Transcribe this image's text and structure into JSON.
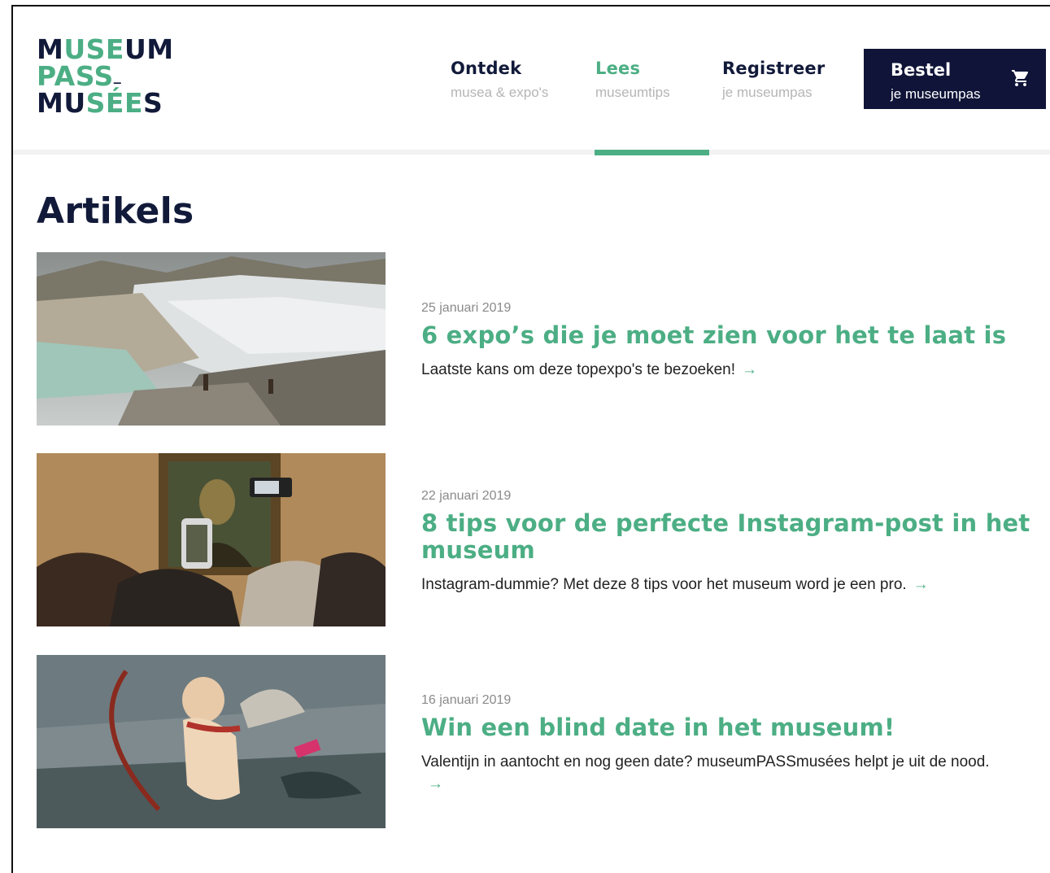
{
  "logo": {
    "line1_a": "M",
    "line1_b": "USE",
    "line1_c": "UM",
    "line2_a": "PASS",
    "line2_b": "_",
    "line3_a": "MU",
    "line3_b": "SÉE",
    "line3_c": "S"
  },
  "nav": [
    {
      "title": "Ontdek",
      "sub": "musea & expo's",
      "active": false
    },
    {
      "title": "Lees",
      "sub": "museumtips",
      "active": true
    },
    {
      "title": "Registreer",
      "sub": "je museumpas",
      "active": false
    }
  ],
  "cta": {
    "title": "Bestel",
    "sub": "je museumpas",
    "icon": "cart-icon"
  },
  "page": {
    "title": "Artikels"
  },
  "articles": [
    {
      "date": "25 januari 2019",
      "title": "6 expo’s die je moet zien voor het te laat is",
      "desc": "Laatste kans om deze topexpo's te bezoeken!",
      "arrow": "→",
      "image": "glacier-photo"
    },
    {
      "date": "22 januari 2019",
      "title": "8 tips voor de perfecte Instagram-post in het museum",
      "desc": "Instagram-dummie? Met deze 8 tips voor het museum word je een pro.",
      "arrow": "→",
      "image": "mona-lisa-crowd-photo"
    },
    {
      "date": "16 januari 2019",
      "title": "Win een blind date in het museum!",
      "desc": "Valentijn in aantocht en nog geen date? museumPASSmusées helpt je uit de nood.",
      "arrow": "→",
      "image": "cupid-painting"
    }
  ],
  "colors": {
    "brand_dark": "#121a3a",
    "brand_green": "#4cae84",
    "cta_bg": "#0f1438"
  }
}
